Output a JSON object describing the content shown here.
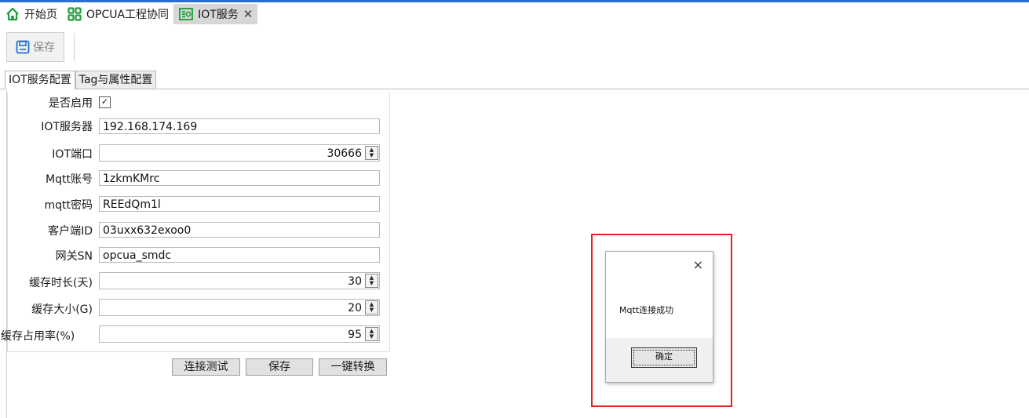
{
  "doc_tabs": [
    {
      "label": "开始页",
      "icon": "home-icon"
    },
    {
      "label": "OPCUA工程协同",
      "icon": "grid-icon"
    },
    {
      "label": "IOT服务",
      "icon": "iot-service-icon",
      "close": "✕"
    }
  ],
  "toolbar": {
    "save_label": "保存",
    "save_icon": "floppy-disk-icon"
  },
  "sub_tabs": [
    "IOT服务配置",
    "Tag与属性配置"
  ],
  "form": {
    "enabled": {
      "label": "是否启用",
      "checked": "✓"
    },
    "server": {
      "label": "IOT服务器",
      "value": "192.168.174.169"
    },
    "port": {
      "label": "IOT端口",
      "value": "30666"
    },
    "mqtt_user": {
      "label": "Mqtt账号",
      "value": "1zkmKMrc"
    },
    "mqtt_pass": {
      "label": "mqtt密码",
      "value": "REEdQm1l"
    },
    "client_id": {
      "label": "客户端ID",
      "value": "03uxx632exoo0"
    },
    "gateway_sn": {
      "label": "网关SN",
      "value": "opcua_smdc"
    },
    "cache_days": {
      "label": "缓存时长(天)",
      "value": "30"
    },
    "cache_size": {
      "label": "缓存大小(G)",
      "value": "20"
    },
    "cache_ratio": {
      "label": "缓存占用率(%)",
      "value": "95"
    }
  },
  "actions": {
    "test": "连接测试",
    "save": "保存",
    "convert": "一键转换"
  },
  "dialog": {
    "message": "Mqtt连接成功",
    "ok": "确定",
    "close": "×"
  },
  "colors": {
    "accent": "#2a6fc9",
    "highlight": "#e2231a",
    "icon_green": "#1f9d3a"
  }
}
